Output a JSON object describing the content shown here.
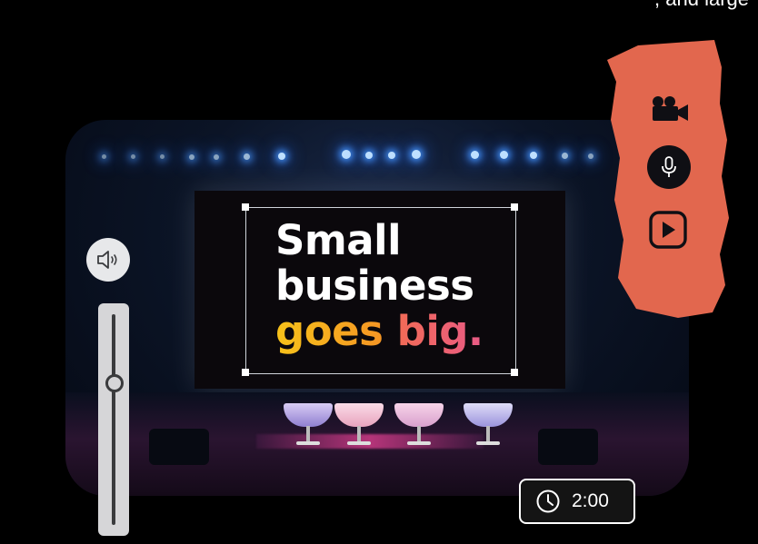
{
  "top_text": ", and large",
  "headline": {
    "line1": "Small",
    "line2": "business",
    "word1": "goes",
    "word2": "big."
  },
  "timer": {
    "label": "2:00"
  },
  "volume": {
    "level": 0.3
  },
  "media_controls": {
    "camera": "video-camera-icon",
    "microphone": "microphone-icon",
    "play": "play-icon"
  },
  "colors": {
    "panel_orange": "#e2674e",
    "headline_yellow": "#f7c21a",
    "headline_pink": "#e85a86"
  }
}
